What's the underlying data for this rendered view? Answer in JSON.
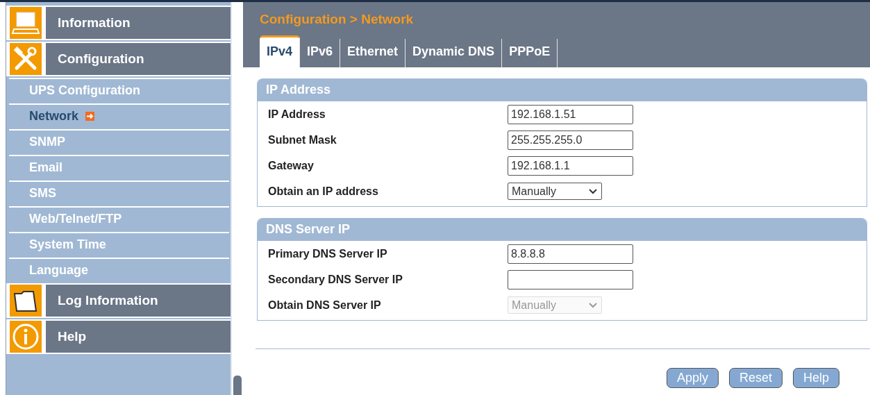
{
  "sidebar": {
    "categories": [
      {
        "label": "Information"
      },
      {
        "label": "Configuration",
        "children": [
          {
            "label": "UPS Configuration",
            "selected": false
          },
          {
            "label": "Network",
            "selected": true
          },
          {
            "label": "SNMP",
            "selected": false
          },
          {
            "label": "Email",
            "selected": false
          },
          {
            "label": "SMS",
            "selected": false
          },
          {
            "label": "Web/Telnet/FTP",
            "selected": false
          },
          {
            "label": "System Time",
            "selected": false
          },
          {
            "label": "Language",
            "selected": false
          }
        ]
      },
      {
        "label": "Log Information"
      },
      {
        "label": "Help"
      }
    ]
  },
  "breadcrumb": "Configuration > Network",
  "tabs": [
    {
      "label": "IPv4",
      "selected": true
    },
    {
      "label": "IPv6",
      "selected": false
    },
    {
      "label": "Ethernet",
      "selected": false
    },
    {
      "label": "Dynamic DNS",
      "selected": false
    },
    {
      "label": "PPPoE",
      "selected": false
    }
  ],
  "sections": [
    {
      "title": "IP Address",
      "rows": [
        {
          "label": "IP Address",
          "kind": "text",
          "value": "192.168.1.51"
        },
        {
          "label": "Subnet Mask",
          "kind": "text",
          "value": "255.255.255.0"
        },
        {
          "label": "Gateway",
          "kind": "text",
          "value": "192.168.1.1"
        },
        {
          "label": "Obtain an IP address",
          "kind": "select",
          "value": "Manually",
          "disabled": false
        }
      ]
    },
    {
      "title": "DNS Server IP",
      "rows": [
        {
          "label": "Primary DNS Server IP",
          "kind": "text",
          "value": "8.8.8.8"
        },
        {
          "label": "Secondary DNS Server IP",
          "kind": "text"
        },
        {
          "label": "Obtain DNS Server IP",
          "kind": "select",
          "value": "Manually",
          "disabled": true
        }
      ]
    }
  ],
  "buttons": [
    "Apply",
    "Reset",
    "Help"
  ]
}
